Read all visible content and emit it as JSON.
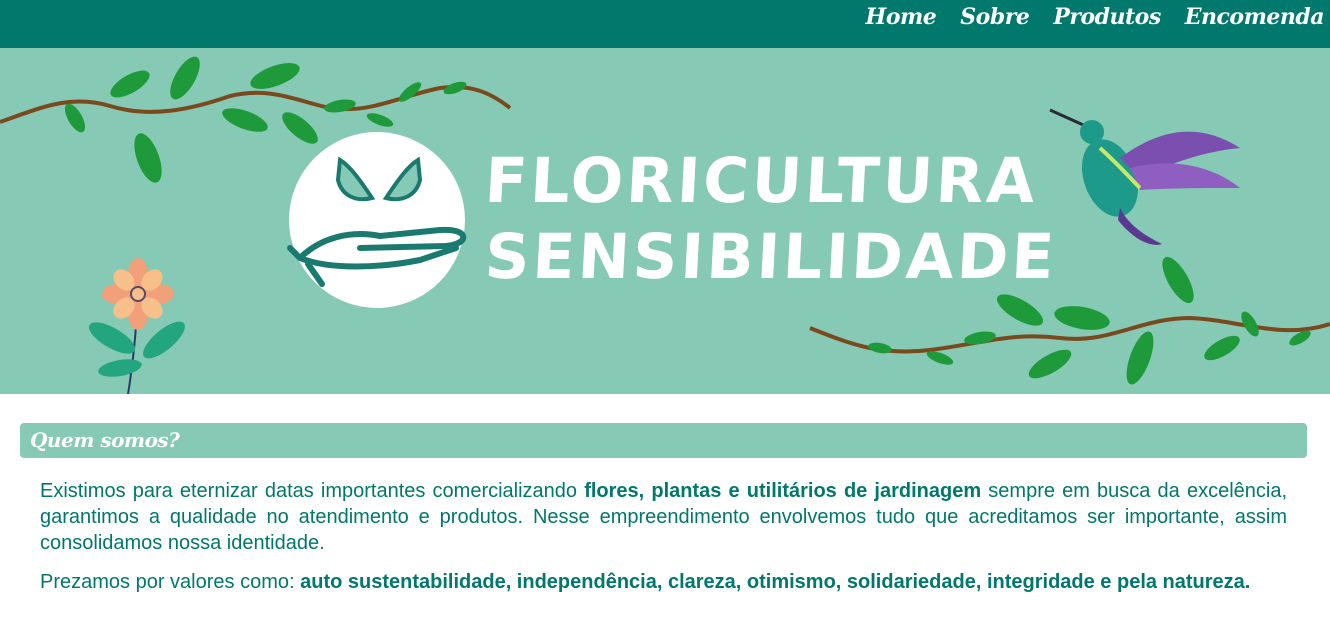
{
  "nav": {
    "home": "Home",
    "sobre": "Sobre",
    "produtos": "Produtos",
    "encomenda": "Encomenda"
  },
  "banner": {
    "title_line1": "FLORICULTURA",
    "title_line2": "SENSIBILIDADE"
  },
  "about": {
    "heading": "Quem somos?",
    "p1_before": "Existimos para eternizar datas importantes comercializando ",
    "p1_bold": "flores, plantas e utilitários de jardinagem",
    "p1_after": " sempre em busca da excelência, garantimos a qualidade no atendimento e produtos. Nesse empreendimento envolvemos tudo que acreditamos ser importante, assim consolidamos nossa identidade.",
    "p2_before": "Prezamos por valores como: ",
    "p2_bold": "auto sustentabilidade, independência, clareza, otimismo, solidariedade, integridade e pela natureza."
  },
  "colors": {
    "primary": "#00786b",
    "banner_bg": "#86c9b5",
    "text": "#00786b",
    "leaf": "#1f9a3a",
    "branch": "#7a4a1e"
  },
  "icons": [
    "hand-butterfly-logo-icon",
    "hummingbird-icon",
    "flower-icon",
    "branch-icon"
  ]
}
